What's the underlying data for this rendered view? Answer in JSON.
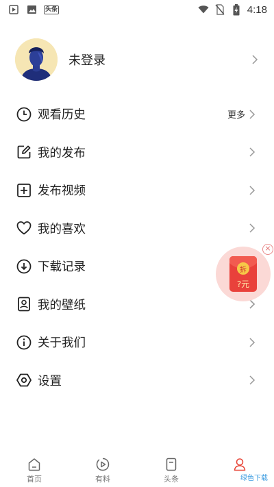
{
  "status_bar": {
    "time": "4:18",
    "news_label": "头条",
    "left_icons": [
      "play-icon",
      "image-icon",
      "news-icon"
    ],
    "right_icons": [
      "wifi-icon",
      "no-sim-icon",
      "battery-charging-icon"
    ]
  },
  "profile": {
    "name": "未登录",
    "avatar_bg": "#f6e6b4"
  },
  "menu": {
    "items": [
      {
        "label": "观看历史",
        "icon": "clock-icon",
        "right_text": "更多"
      },
      {
        "label": "我的发布",
        "icon": "edit-icon"
      },
      {
        "label": "发布视频",
        "icon": "add-square-icon"
      },
      {
        "label": "我的喜欢",
        "icon": "heart-icon"
      },
      {
        "label": "下载记录",
        "icon": "download-icon"
      },
      {
        "label": "我的壁纸",
        "icon": "wallpaper-icon"
      },
      {
        "label": "关于我们",
        "icon": "info-icon"
      },
      {
        "label": "设置",
        "icon": "settings-icon"
      }
    ]
  },
  "red_packet": {
    "coin_text": "拆",
    "amount_text": "?元",
    "packet_color": "#e9413b"
  },
  "bottom_nav": {
    "items": [
      {
        "label": "首页",
        "icon": "home-icon"
      },
      {
        "label": "有料",
        "icon": "play-circle-icon"
      },
      {
        "label": "头条",
        "icon": "bookmark-icon"
      },
      {
        "label": "",
        "icon": "profile-icon",
        "active": true
      }
    ],
    "active_color": "#e84a3c"
  },
  "watermark": "绿色下载"
}
